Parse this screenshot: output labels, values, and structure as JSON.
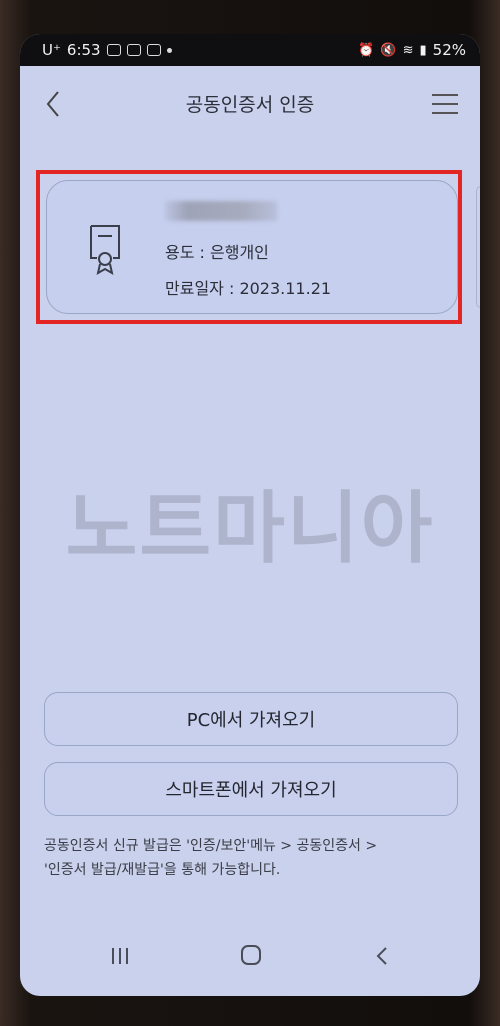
{
  "status_bar": {
    "carrier": "U⁺",
    "time": "6:53",
    "battery": "52%"
  },
  "header": {
    "title": "공동인증서 인증",
    "back_icon": "chevron-left-icon",
    "menu_icon": "hamburger-menu-icon"
  },
  "certificate": {
    "usage": "용도 : 은행개인",
    "expiry": "만료일자 : 2023.11.21",
    "icon": "certificate-icon"
  },
  "watermark": "노트마니아",
  "buttons": {
    "import_pc": "PC에서 가져오기",
    "import_phone": "스마트폰에서 가져오기"
  },
  "info": {
    "line1": "공동인증서 신규 발급은 '인증/보안'메뉴 > 공동인증서 >",
    "line2": "'인증서 발급/재발급'을 통해 가능합니다."
  },
  "colors": {
    "highlight": "#e32624",
    "screen_bg": "#c9d1ec"
  }
}
